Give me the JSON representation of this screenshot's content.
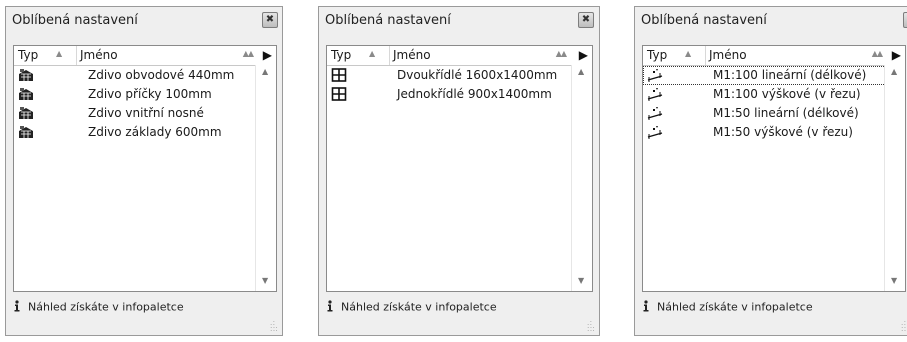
{
  "panels": [
    {
      "title": "Oblíbená nastavení",
      "header": {
        "typ": "Typ",
        "name": "Jméno"
      },
      "rows": [
        {
          "icon": "wall-material-icon",
          "name": "Zdivo obvodové 440mm"
        },
        {
          "icon": "wall-material-icon",
          "name": "Zdivo příčky 100mm"
        },
        {
          "icon": "wall-material-icon",
          "name": "Zdivo vnitřní nosné"
        },
        {
          "icon": "wall-material-icon",
          "name": "Zdivo základy 600mm"
        }
      ],
      "footer": "Náhled získáte v infopaletce"
    },
    {
      "title": "Oblíbená nastavení",
      "header": {
        "typ": "Typ",
        "name": "Jméno"
      },
      "rows": [
        {
          "icon": "window-icon",
          "name": "Dvoukřídlé 1600x1400mm"
        },
        {
          "icon": "window-icon",
          "name": "Jednokřídlé 900x1400mm"
        }
      ],
      "footer": "Náhled získáte v infopaletce"
    },
    {
      "title": "Oblíbená nastavení",
      "header": {
        "typ": "Typ",
        "name": "Jméno"
      },
      "rows": [
        {
          "icon": "dimension-icon",
          "name": "M1:100 lineární (délkové)"
        },
        {
          "icon": "dimension-icon",
          "name": "M1:100 výškové (v řezu)"
        },
        {
          "icon": "dimension-icon",
          "name": "M1:50 lineární (délkové)"
        },
        {
          "icon": "dimension-icon",
          "name": "M1:50 výškové (v řezu)"
        }
      ],
      "footer": "Náhled získáte v infopaletce"
    }
  ]
}
